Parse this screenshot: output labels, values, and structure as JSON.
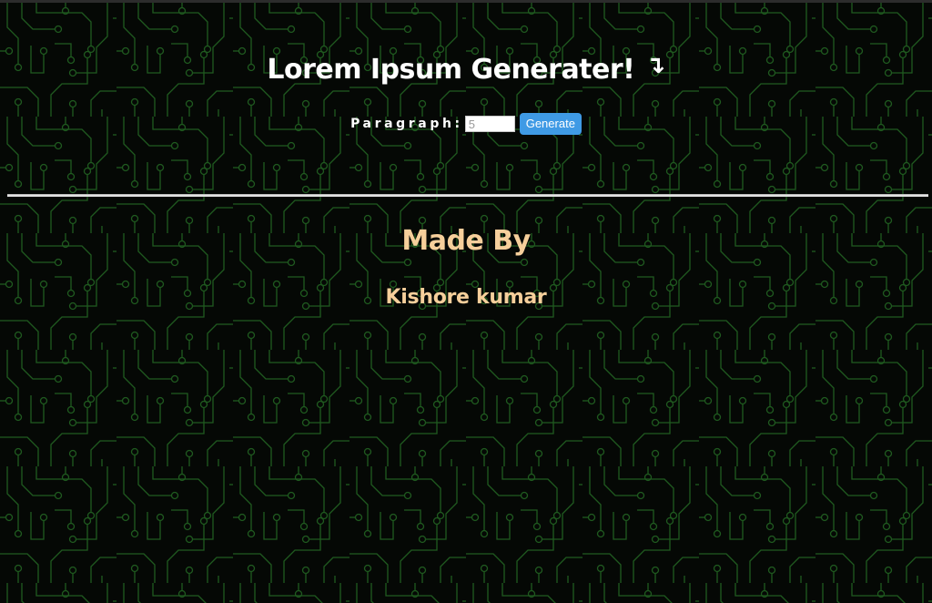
{
  "header": {
    "title": "Lorem Ipsum Generater!",
    "arrow_icon": "curved-arrow-down-right-icon",
    "arrow_glyph": "↴"
  },
  "form": {
    "paragraph_label": "Paragraph:",
    "paragraph_placeholder": "5",
    "paragraph_value": "",
    "generate_label": "Generate"
  },
  "footer": {
    "made_by": "Made By",
    "author": "Kishore kumar"
  },
  "colors": {
    "background": "#050805",
    "circuit": "#1f5a1f",
    "title": "#ffffff",
    "accent_peach": "#f6cf9b",
    "button": "#3f9ae5",
    "divider": "#e2e2e2"
  }
}
